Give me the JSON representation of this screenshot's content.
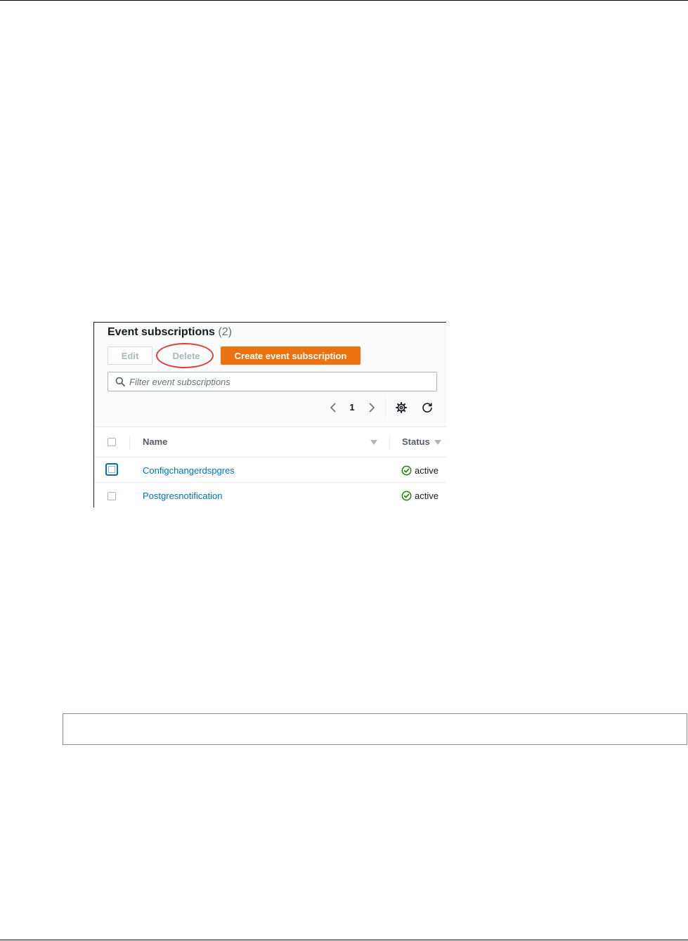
{
  "panel": {
    "title": "Event subscriptions",
    "count": "(2)",
    "buttons": {
      "edit": "Edit",
      "delete": "Delete",
      "create": "Create event subscription"
    },
    "search": {
      "placeholder": "Filter event subscriptions",
      "value": ""
    },
    "pagination": {
      "current_page": "1"
    },
    "table": {
      "columns": [
        "Name",
        "Status"
      ],
      "rows": [
        {
          "name": "Configchangerdspgres",
          "status": "active"
        },
        {
          "name": "Postgresnotification",
          "status": "active"
        }
      ]
    }
  },
  "icons": {
    "search": "search-icon",
    "prev": "chevron-left-icon",
    "next": "chevron-right-icon",
    "settings": "gear-icon",
    "refresh": "refresh-icon",
    "status": "check-circle-icon",
    "sort": "caret-down-icon"
  },
  "colors": {
    "primary_button": "#ec7211",
    "link": "#0073bb",
    "status_success": "#1d8102",
    "highlight_circle": "#e03b3b",
    "disabled_text": "#aab7b8"
  }
}
